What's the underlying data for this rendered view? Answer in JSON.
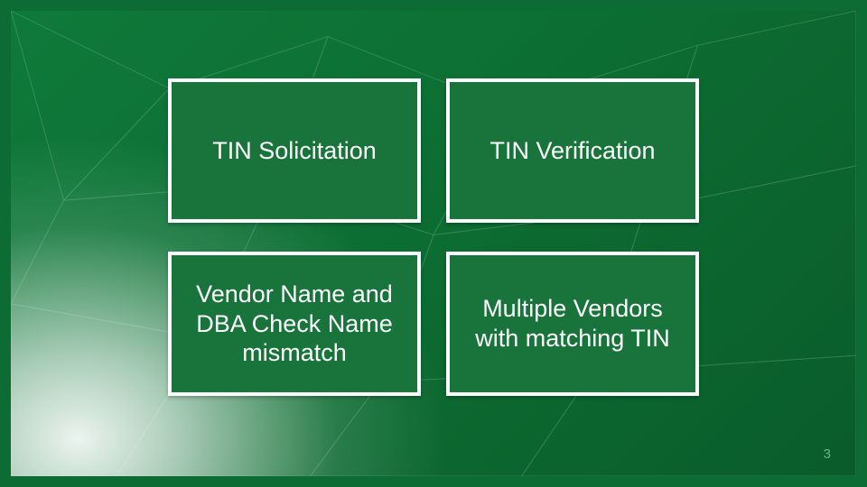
{
  "slide": {
    "cards": [
      {
        "label": "TIN Solicitation"
      },
      {
        "label": "TIN Verification"
      },
      {
        "label": "Vendor Name and DBA Check Name mismatch"
      },
      {
        "label": "Multiple Vendors with matching TIN"
      }
    ],
    "page_number": "3"
  }
}
